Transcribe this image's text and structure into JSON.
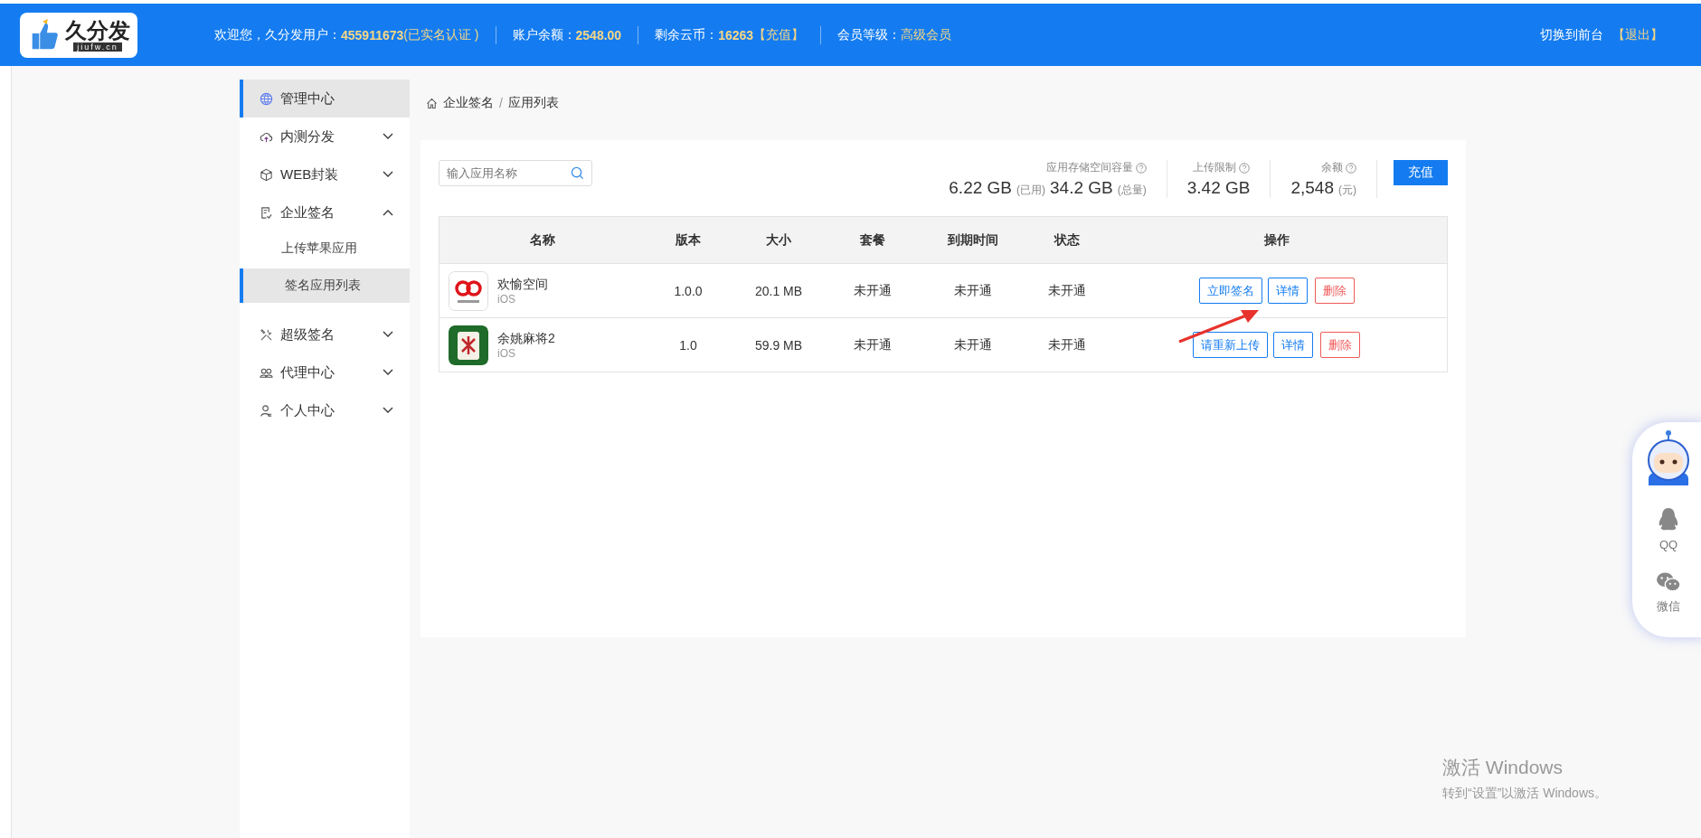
{
  "header": {
    "logo": {
      "name": "久分发",
      "domain": "jiufw.cn"
    },
    "info": [
      {
        "parts": [
          {
            "text": "欢迎您，久分发用户：",
            "kind": "label"
          },
          {
            "text": "455911673",
            "kind": "value"
          },
          {
            "text": "(已实名认证 )",
            "kind": "note"
          }
        ]
      },
      {
        "parts": [
          {
            "text": "账户余额：",
            "kind": "label"
          },
          {
            "text": "2548.00",
            "kind": "value"
          }
        ]
      },
      {
        "parts": [
          {
            "text": "剩余云币：",
            "kind": "label"
          },
          {
            "text": "16263",
            "kind": "value"
          },
          {
            "text": "【充值】",
            "kind": "link"
          }
        ]
      },
      {
        "parts": [
          {
            "text": "会员等级：",
            "kind": "label"
          },
          {
            "text": "高级会员",
            "kind": "note"
          }
        ]
      }
    ],
    "switch_link": "切换到前台",
    "logout_link": "【退出】"
  },
  "sidebar": {
    "items": [
      {
        "label": "管理中心",
        "kind": "globe",
        "selected": true
      },
      {
        "label": "内测分发",
        "kind": "cloud",
        "selected": false,
        "expanded": false
      },
      {
        "label": "WEB封装",
        "kind": "cube",
        "selected": false,
        "expanded": false
      },
      {
        "label": "企业签名",
        "kind": "doc",
        "selected": false,
        "expanded": true,
        "children": [
          {
            "label": "上传苹果应用",
            "selected": false
          },
          {
            "label": "签名应用列表",
            "selected": true
          }
        ]
      },
      {
        "label": "超级签名",
        "kind": "tools",
        "selected": false,
        "expanded": false
      },
      {
        "label": "代理中心",
        "kind": "group",
        "selected": false,
        "expanded": false
      },
      {
        "label": "个人中心",
        "kind": "person",
        "selected": false,
        "expanded": false
      }
    ]
  },
  "breadcrumb": {
    "items": [
      "企业签名",
      "应用列表"
    ],
    "separator": "/"
  },
  "search": {
    "placeholder": "输入应用名称"
  },
  "stats": {
    "storage": {
      "label": "应用存储空间容量",
      "used": "6.22 GB",
      "used_unit": "(已用)",
      "total": "34.2 GB",
      "total_unit": "(总量)"
    },
    "upload_limit": {
      "label": "上传限制",
      "value": "3.42 GB"
    },
    "balance": {
      "label": "余额",
      "value": "2,548",
      "unit": "(元)"
    },
    "recharge_button": "充值"
  },
  "table": {
    "columns": [
      "名称",
      "版本",
      "大小",
      "套餐",
      "到期时间",
      "状态",
      "操作"
    ],
    "rows": [
      {
        "kind": "rings",
        "name": "欢愉空间",
        "platform": "iOS",
        "version": "1.0.0",
        "size": "20.1 MB",
        "plan": "未开通",
        "expiry": "未开通",
        "status": "未开通",
        "actions": [
          {
            "label": "立即签名",
            "kind": "primary"
          },
          {
            "label": "详情",
            "kind": "primary"
          },
          {
            "label": "删除",
            "kind": "danger"
          }
        ]
      },
      {
        "kind": "mahjong",
        "name": "余姚麻将2",
        "platform": "iOS",
        "version": "1.0",
        "size": "59.9 MB",
        "plan": "未开通",
        "expiry": "未开通",
        "status": "未开通",
        "actions": [
          {
            "label": "请重新上传",
            "kind": "primary"
          },
          {
            "label": "详情",
            "kind": "primary"
          },
          {
            "label": "删除",
            "kind": "danger"
          }
        ]
      }
    ]
  },
  "contact_widget": {
    "items": [
      {
        "label": "QQ",
        "kind": "penguin"
      },
      {
        "label": "微信",
        "kind": "chat"
      }
    ]
  },
  "windows_notice": {
    "title": "激活 Windows",
    "text": "转到“设置”以激活 Windows。"
  }
}
